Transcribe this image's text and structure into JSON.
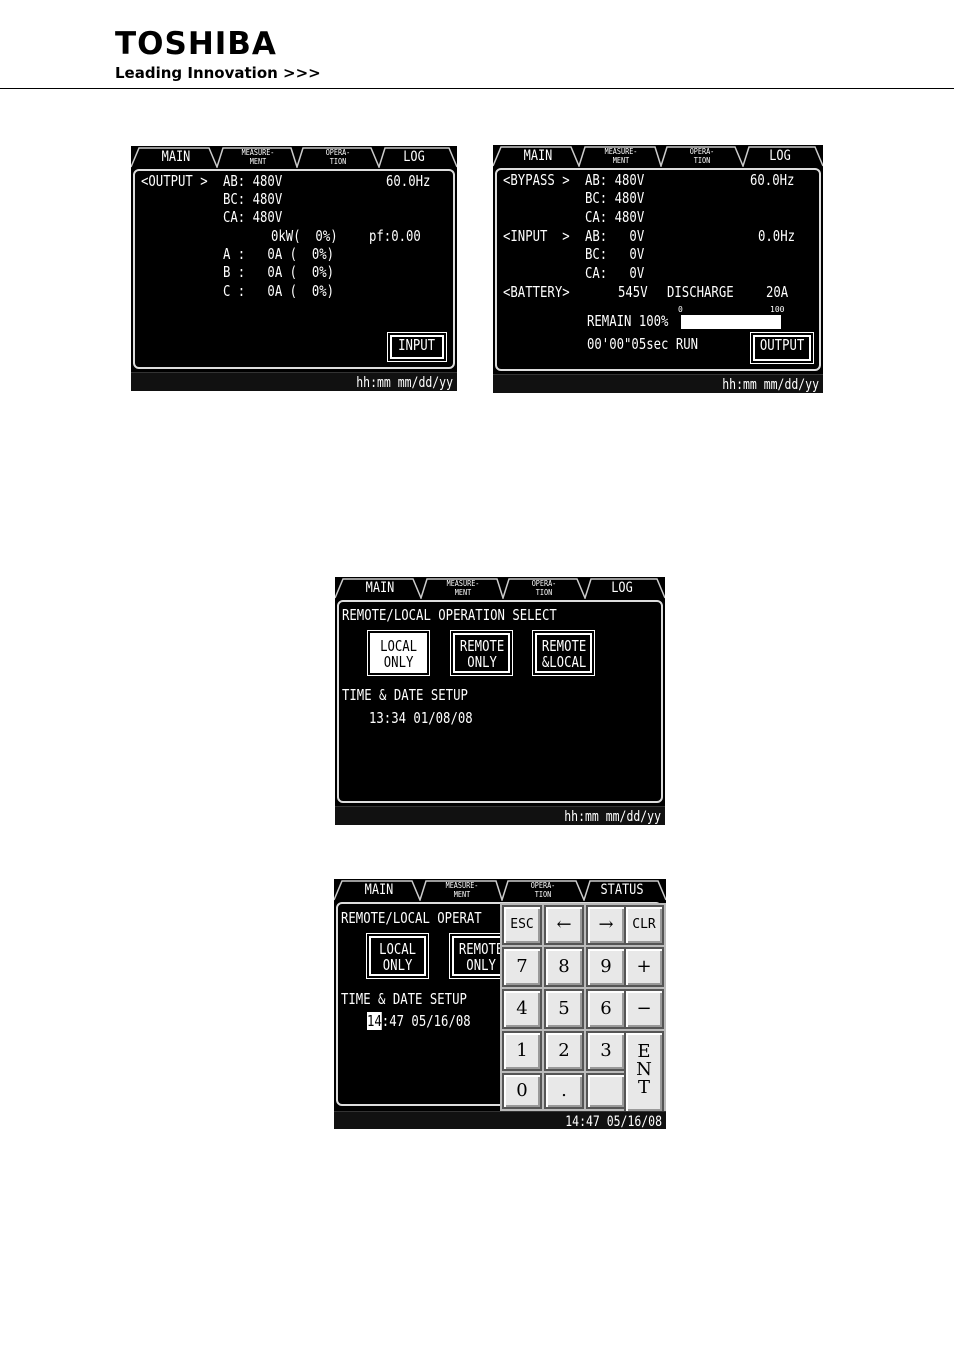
{
  "header": {
    "brand": "TOSHIBA",
    "tagline": "Leading Innovation >>>"
  },
  "tabs_a": [
    "MAIN",
    "MEASURE-\nMENT",
    "OPERA-\nTION",
    "LOG"
  ],
  "tabs_d": [
    "MAIN",
    "MEASURE-\nMENT",
    "OPERA-\nTION",
    "STATUS"
  ],
  "screen1": {
    "section": "<OUTPUT >",
    "ab": "AB: 480V",
    "bc": "BC: 480V",
    "ca": "CA: 480V",
    "freq": "60.0Hz",
    "kw": "0kW(  0%)",
    "pf": "pf:0.00",
    "a": "A :   0A (  0%)",
    "b": "B :   0A (  0%)",
    "c": "C :   0A (  0%)",
    "button": "INPUT",
    "status": "hh:mm mm/dd/yy"
  },
  "screen2": {
    "bypass": "<BYPASS >",
    "bypass_ab": "AB: 480V",
    "bypass_bc": "BC: 480V",
    "bypass_ca": "CA: 480V",
    "bypass_freq": "60.0Hz",
    "input": "<INPUT  >",
    "input_ab": "AB:   0V",
    "input_bc": "BC:   0V",
    "input_ca": "CA:   0V",
    "input_freq": "0.0Hz",
    "battery": "<BATTERY>",
    "battery_v": "545V",
    "discharge": "DISCHARGE",
    "battery_a": "20A",
    "remain": "REMAIN 100%",
    "remain_level": 1.0,
    "bar_min": "0",
    "bar_max": "100",
    "runtime": "00'00\"05sec RUN",
    "button": "OUTPUT",
    "status": "hh:mm mm/dd/yy"
  },
  "screen3": {
    "title": "REMOTE/LOCAL OPERATION SELECT",
    "local": "LOCAL\nONLY",
    "remote": "REMOTE\nONLY",
    "remote_local": "REMOTE\n&LOCAL",
    "time_title": "TIME & DATE SETUP",
    "time_value": "13:34 01/08/08",
    "status": "hh:mm mm/dd/yy"
  },
  "screen4": {
    "title": "REMOTE/LOCAL OPERAT",
    "local": "LOCAL\nONLY",
    "remote": "REMOTE\nONLY",
    "time_title": "TIME & DATE SETUP",
    "time_cursor": "14",
    "time_rest": ":47 05/16/08",
    "status": "14:47 05/16/08",
    "keys": [
      "ESC",
      "←",
      "→",
      "CLR",
      "7",
      "8",
      "9",
      "+",
      "4",
      "5",
      "6",
      "−",
      "1",
      "2",
      "3",
      "0",
      ".",
      ""
    ],
    "ent": "E\nN\nT"
  }
}
